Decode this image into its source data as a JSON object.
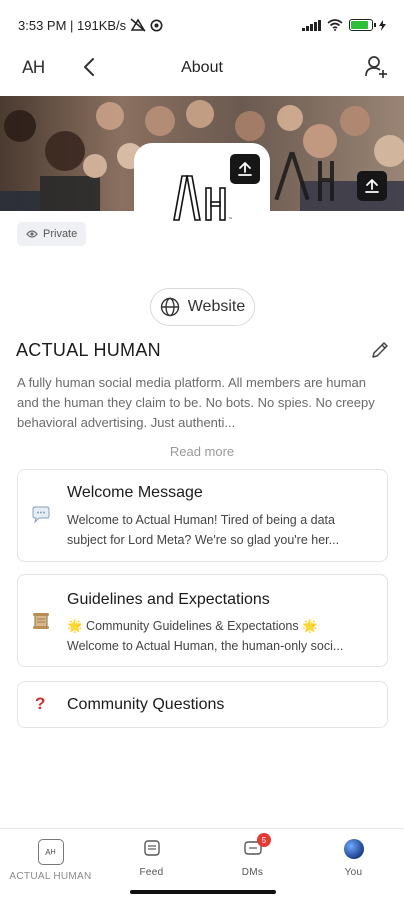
{
  "status_bar": {
    "time_speed": "3:53 PM | 191KB/s",
    "battery_percent": 85
  },
  "header": {
    "logo_text": "AH",
    "title": "About"
  },
  "community": {
    "logo_text": "AH",
    "privacy_label": "Private",
    "website_label": "Website",
    "name": "ACTUAL HUMAN",
    "description": "A fully human social media platform. All members are human and the human they claim to be. No bots. No spies. No creepy behavioral advertising. Just authenti...",
    "read_more": "Read more"
  },
  "cards": [
    {
      "icon": "speech-bubble-icon",
      "title": "Welcome Message",
      "lines": [
        "Welcome to Actual Human! Tired of being a data",
        "subject for Lord Meta? We're so glad you're her..."
      ]
    },
    {
      "icon": "scroll-icon",
      "title": "Guidelines and Expectations",
      "lines": [
        "🌟 Community Guidelines & Expectations 🌟",
        "Welcome to Actual Human, the human-only soci..."
      ]
    },
    {
      "icon": "question-mark-icon",
      "title": "Community Questions",
      "lines": []
    }
  ],
  "bottom_nav": {
    "items": [
      {
        "label": "ACTUAL HUMAN",
        "icon": "community-logo-icon"
      },
      {
        "label": "Feed",
        "icon": "feed-icon"
      },
      {
        "label": "DMs",
        "icon": "dms-icon",
        "badge": "5"
      },
      {
        "label": "You",
        "icon": "avatar-icon"
      }
    ]
  },
  "colors": {
    "badge": "#e53935",
    "battery": "#2fbf3a",
    "question_icon": "#d32f2f"
  }
}
